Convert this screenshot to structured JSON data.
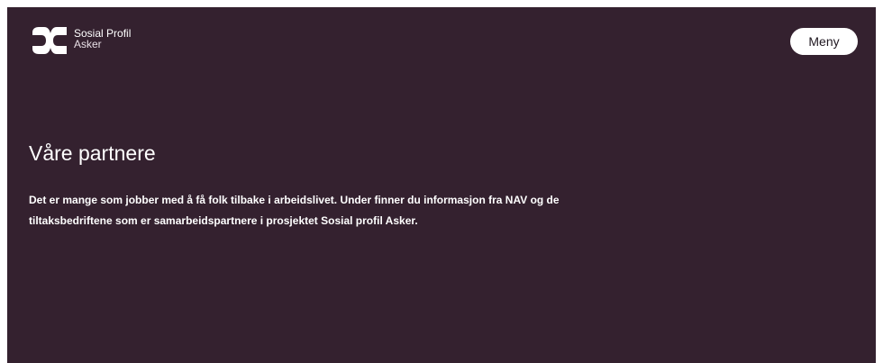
{
  "site": {
    "logo": {
      "name": "Sosial Profil",
      "location": "Asker",
      "icon": "sosial-profil-logo-icon"
    },
    "menu_label": "Meny"
  },
  "hero": {
    "title": "Våre partnere",
    "body_lines": [
      "Det er mange som jobber med å få folk tilbake i arbeidslivet. Under finner du informasjon fra NAV og de",
      "tiltaksbedriftene som er samarbeidspartnere i prosjektet Sosial profil Asker."
    ]
  },
  "colors": {
    "background": "#34212f",
    "foreground": "#ffffff",
    "button_background": "#ffffff",
    "button_text": "#1f1720"
  }
}
